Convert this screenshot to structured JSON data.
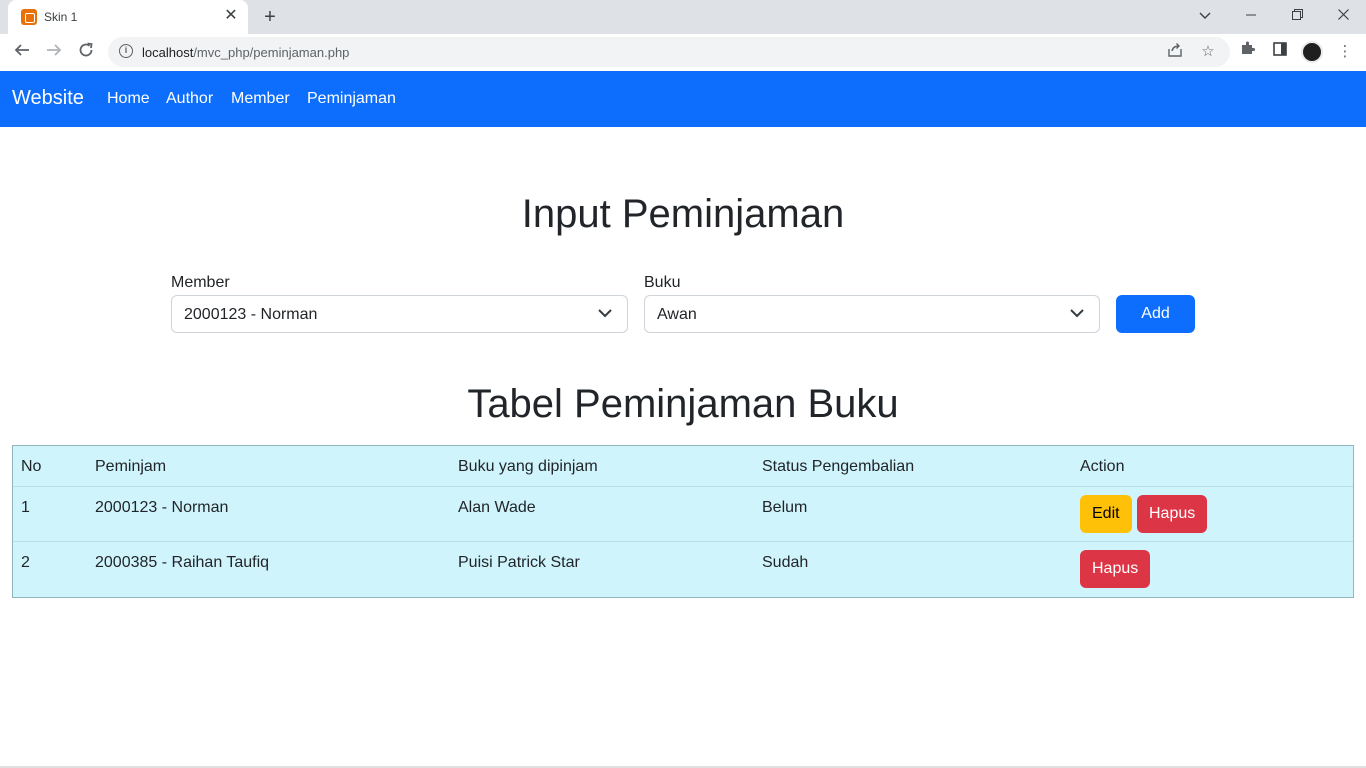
{
  "browser": {
    "tab_title": "Skin 1",
    "url_host": "localhost",
    "url_path": "/mvc_php/peminjaman.php",
    "window_controls": [
      "chevron-down",
      "minimize",
      "restore",
      "close"
    ]
  },
  "navbar": {
    "brand": "Website",
    "links": [
      "Home",
      "Author",
      "Member",
      "Peminjaman"
    ],
    "color": "#0d6efd"
  },
  "form": {
    "title": "Input Peminjaman",
    "member_label": "Member",
    "member_value": "2000123 - Norman",
    "buku_label": "Buku",
    "buku_value": "Awan",
    "add_label": "Add"
  },
  "table": {
    "title": "Tabel Peminjaman Buku",
    "headers": [
      "No",
      "Peminjam",
      "Buku yang dipinjam",
      "Status Pengembalian",
      "Action"
    ],
    "rows": [
      {
        "no": "1",
        "peminjam": "2000123 - Norman",
        "buku": "Alan Wade",
        "status": "Belum",
        "edit": "Edit",
        "hapus": "Hapus"
      },
      {
        "no": "2",
        "peminjam": "2000385 - Raihan Taufiq",
        "buku": "Puisi Patrick Star",
        "status": "Sudah",
        "hapus": "Hapus"
      }
    ]
  }
}
